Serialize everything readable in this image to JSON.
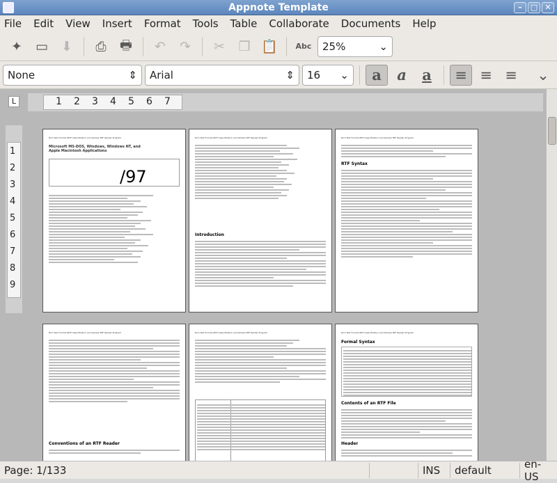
{
  "window": {
    "title": "Appnote Template"
  },
  "menu": [
    "File",
    "Edit",
    "View",
    "Insert",
    "Format",
    "Tools",
    "Table",
    "Collaborate",
    "Documents",
    "Help"
  ],
  "toolbar": {
    "zoom": "25%"
  },
  "format": {
    "style": "None",
    "font": "Arial",
    "size": "16"
  },
  "ruler": {
    "h": [
      "1",
      "2",
      "3",
      "4",
      "5",
      "6",
      "7"
    ],
    "v": [
      "1",
      "2",
      "3",
      "4",
      "5",
      "6",
      "7",
      "8",
      "9"
    ]
  },
  "pages": {
    "p1_title": "Microsoft MS-DOS, Windows, Windows NT, and Apple Macintosh Applications",
    "p1_date": "/97",
    "header_text": "Rich Text Format (RTF) Specification and Sample RTF Reader Program",
    "p2_heading": "Introduction",
    "p3_heading": "RTF Syntax",
    "p4_heading": "Conventions of an RTF Reader",
    "p6_heading1": "Formal Syntax",
    "p6_heading2": "Contents of an RTF File",
    "p6_heading3": "Header"
  },
  "status": {
    "page": "Page: 1/133",
    "ins": "INS",
    "mode": "default",
    "lang": "en-US"
  }
}
